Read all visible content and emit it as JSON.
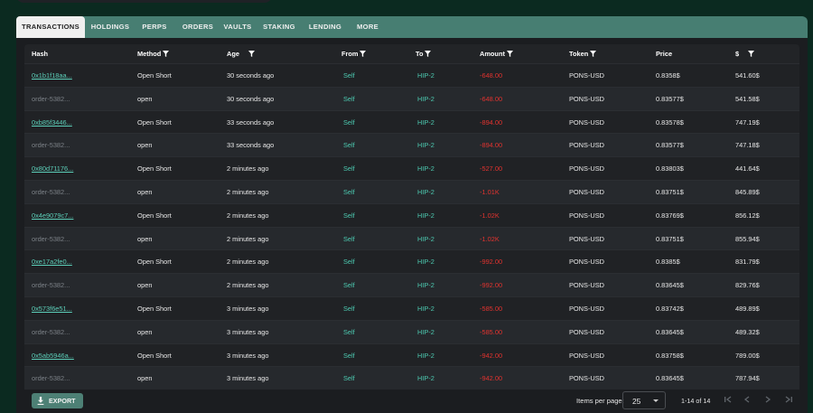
{
  "tabs": [
    {
      "label": "TRANSACTIONS",
      "active": true
    },
    {
      "label": "HOLDINGS",
      "active": false
    },
    {
      "label": "PERPS",
      "active": false
    },
    {
      "label": "ORDERS",
      "active": false
    },
    {
      "label": "VAULTS",
      "active": false
    },
    {
      "label": "STAKING",
      "active": false
    },
    {
      "label": "LENDING",
      "active": false
    },
    {
      "label": "MORE",
      "active": false
    }
  ],
  "columns": [
    {
      "key": "hash",
      "label": "Hash",
      "filter": false
    },
    {
      "key": "method",
      "label": "Method",
      "filter": true
    },
    {
      "key": "age",
      "label": "Age",
      "filter": true
    },
    {
      "key": "from",
      "label": "From",
      "filter": true
    },
    {
      "key": "to",
      "label": "To",
      "filter": true
    },
    {
      "key": "amount",
      "label": "Amount",
      "filter": true
    },
    {
      "key": "token",
      "label": "Token",
      "filter": true
    },
    {
      "key": "price",
      "label": "Price",
      "filter": false
    },
    {
      "key": "usd",
      "label": "$",
      "filter": true
    }
  ],
  "rows": [
    {
      "hash": "0x1b1f18aa...",
      "hash_link": true,
      "method": "Open Short",
      "age": "30 seconds ago",
      "from": "Self",
      "to": "HIP-2",
      "amount": "-648.00",
      "token": "PONS-USD",
      "price": "0.8358$",
      "usd": "541.60$"
    },
    {
      "hash": "order-5382...",
      "hash_link": false,
      "method": "open",
      "age": "30 seconds ago",
      "from": "Self",
      "to": "HIP-2",
      "amount": "-648.00",
      "token": "PONS-USD",
      "price": "0.83577$",
      "usd": "541.58$"
    },
    {
      "hash": "0xb85f3446...",
      "hash_link": true,
      "method": "Open Short",
      "age": "33 seconds ago",
      "from": "Self",
      "to": "HIP-2",
      "amount": "-894.00",
      "token": "PONS-USD",
      "price": "0.83578$",
      "usd": "747.19$"
    },
    {
      "hash": "order-5382...",
      "hash_link": false,
      "method": "open",
      "age": "33 seconds ago",
      "from": "Self",
      "to": "HIP-2",
      "amount": "-894.00",
      "token": "PONS-USD",
      "price": "0.83577$",
      "usd": "747.18$"
    },
    {
      "hash": "0x80d71176...",
      "hash_link": true,
      "method": "Open Short",
      "age": "2 minutes ago",
      "from": "Self",
      "to": "HIP-2",
      "amount": "-527.00",
      "token": "PONS-USD",
      "price": "0.83803$",
      "usd": "441.64$"
    },
    {
      "hash": "order-5382...",
      "hash_link": false,
      "method": "open",
      "age": "2 minutes ago",
      "from": "Self",
      "to": "HIP-2",
      "amount": "-1.01K",
      "token": "PONS-USD",
      "price": "0.83751$",
      "usd": "845.89$"
    },
    {
      "hash": "0x4e9079c7...",
      "hash_link": true,
      "method": "Open Short",
      "age": "2 minutes ago",
      "from": "Self",
      "to": "HIP-2",
      "amount": "-1.02K",
      "token": "PONS-USD",
      "price": "0.83769$",
      "usd": "856.12$"
    },
    {
      "hash": "order-5382...",
      "hash_link": false,
      "method": "open",
      "age": "2 minutes ago",
      "from": "Self",
      "to": "HIP-2",
      "amount": "-1.02K",
      "token": "PONS-USD",
      "price": "0.83751$",
      "usd": "855.94$"
    },
    {
      "hash": "0xe17a2fe0...",
      "hash_link": true,
      "method": "Open Short",
      "age": "2 minutes ago",
      "from": "Self",
      "to": "HIP-2",
      "amount": "-992.00",
      "token": "PONS-USD",
      "price": "0.8385$",
      "usd": "831.79$"
    },
    {
      "hash": "order-5382...",
      "hash_link": false,
      "method": "open",
      "age": "2 minutes ago",
      "from": "Self",
      "to": "HIP-2",
      "amount": "-992.00",
      "token": "PONS-USD",
      "price": "0.83645$",
      "usd": "829.76$"
    },
    {
      "hash": "0x573f6e51...",
      "hash_link": true,
      "method": "Open Short",
      "age": "3 minutes ago",
      "from": "Self",
      "to": "HIP-2",
      "amount": "-585.00",
      "token": "PONS-USD",
      "price": "0.83742$",
      "usd": "489.89$"
    },
    {
      "hash": "order-5382...",
      "hash_link": false,
      "method": "open",
      "age": "3 minutes ago",
      "from": "Self",
      "to": "HIP-2",
      "amount": "-585.00",
      "token": "PONS-USD",
      "price": "0.83645$",
      "usd": "489.32$"
    },
    {
      "hash": "0x5ab5946a...",
      "hash_link": true,
      "method": "Open Short",
      "age": "3 minutes ago",
      "from": "Self",
      "to": "HIP-2",
      "amount": "-942.00",
      "token": "PONS-USD",
      "price": "0.83758$",
      "usd": "789.00$"
    },
    {
      "hash": "order-5382...",
      "hash_link": false,
      "method": "open",
      "age": "3 minutes ago",
      "from": "Self",
      "to": "HIP-2",
      "amount": "-942.00",
      "token": "PONS-USD",
      "price": "0.83645$",
      "usd": "787.94$"
    }
  ],
  "footer": {
    "export_label": "EXPORT",
    "items_per_page_label": "Items per page:",
    "items_per_page_value": "25",
    "range_label": "1-14 of 14"
  },
  "pagination_icons": [
    "first-page-icon",
    "prev-page-icon",
    "next-page-icon",
    "last-page-icon"
  ],
  "colors": {
    "background": "#0b2a20",
    "tab_bar": "#477e72",
    "table_bg": "#1b1d20",
    "link": "#5ccfb9",
    "teal_text": "#4cc9b0",
    "negative": "#e2332f",
    "export_button": "#4d8075"
  }
}
